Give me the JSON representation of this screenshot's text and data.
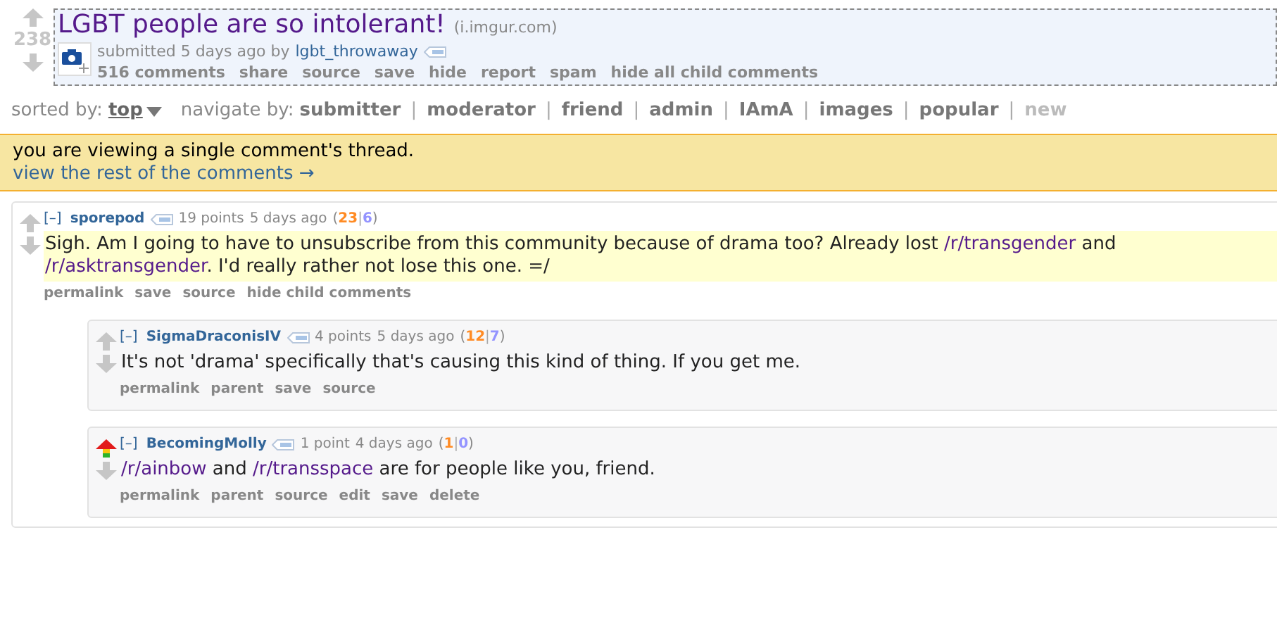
{
  "post": {
    "score": "238",
    "title": "LGBT people are so intolerant!",
    "domain": "(i.imgur.com)",
    "tagline_prefix": "submitted 5 days ago by",
    "author": "lgbt_throwaway",
    "buttons": [
      "516 comments",
      "share",
      "source",
      "save",
      "hide",
      "report",
      "spam",
      "hide all child comments"
    ]
  },
  "sort_bar": {
    "label": "sorted by:",
    "value": "top",
    "navigate_label": "navigate by:",
    "separators": [
      "|",
      "|",
      "|",
      "|",
      "|",
      "|",
      "|"
    ],
    "items": [
      {
        "label": "submitter",
        "disabled": false
      },
      {
        "label": "moderator",
        "disabled": false
      },
      {
        "label": "friend",
        "disabled": false
      },
      {
        "label": "admin",
        "disabled": false
      },
      {
        "label": "IAmA",
        "disabled": false
      },
      {
        "label": "images",
        "disabled": false
      },
      {
        "label": "popular",
        "disabled": false
      },
      {
        "label": "new",
        "disabled": true
      }
    ]
  },
  "banner": {
    "message": "you are viewing a single comment's thread.",
    "link": "view the rest of the comments →"
  },
  "comments": [
    {
      "collapse": "[–]",
      "author": "sporepod",
      "points": "19 points",
      "time": "5 days ago",
      "vote_open": "(",
      "ups": "23",
      "vote_sep": "|",
      "downs": "6",
      "vote_close": ")",
      "upvoted": false,
      "highlighted": true,
      "body": [
        {
          "kind": "text",
          "text": "Sigh. Am I going to have to unsubscribe from this community because of drama too? Already lost "
        },
        {
          "kind": "link",
          "text": "/r/transgender"
        },
        {
          "kind": "text",
          "text": " and "
        },
        {
          "kind": "link",
          "text": "/r/asktransgender"
        },
        {
          "kind": "text",
          "text": ". I'd really rather not lose this one. =/"
        }
      ],
      "buttons": [
        "permalink",
        "save",
        "source",
        "hide child comments"
      ],
      "children": [
        {
          "collapse": "[–]",
          "author": "SigmaDraconisIV",
          "points": "4 points",
          "time": "5 days ago",
          "vote_open": "(",
          "ups": "12",
          "vote_sep": "|",
          "downs": "7",
          "vote_close": ")",
          "upvoted": false,
          "highlighted": false,
          "body": [
            {
              "kind": "text",
              "text": "It's not 'drama' specifically that's causing this kind of thing. If you get me."
            }
          ],
          "buttons": [
            "permalink",
            "parent",
            "save",
            "source"
          ]
        },
        {
          "collapse": "[–]",
          "author": "BecomingMolly",
          "points": "1 point",
          "time": "4 days ago",
          "vote_open": "(",
          "ups": "1",
          "vote_sep": "|",
          "downs": "0",
          "vote_close": ")",
          "upvoted": true,
          "highlighted": false,
          "body": [
            {
              "kind": "link",
              "text": "/r/ainbow"
            },
            {
              "kind": "text",
              "text": " and "
            },
            {
              "kind": "link",
              "text": "/r/transspace"
            },
            {
              "kind": "text",
              "text": " are for people like you, friend."
            }
          ],
          "buttons": [
            "permalink",
            "parent",
            "source",
            "edit",
            "save",
            "delete"
          ]
        }
      ]
    }
  ]
}
